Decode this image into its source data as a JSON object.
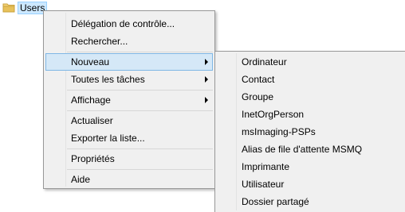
{
  "tree": {
    "node_label": "Users",
    "node_icon": "folder-icon"
  },
  "context_menu": {
    "items": [
      {
        "label": "Délégation de contrôle..."
      },
      {
        "label": "Rechercher..."
      },
      {
        "label": "Nouveau",
        "has_submenu": true,
        "active": true
      },
      {
        "label": "Toutes les tâches",
        "has_submenu": true
      },
      {
        "label": "Affichage",
        "has_submenu": true
      },
      {
        "label": "Actualiser"
      },
      {
        "label": "Exporter la liste..."
      },
      {
        "label": "Propriétés"
      },
      {
        "label": "Aide"
      }
    ]
  },
  "submenu_nouveau": {
    "items": [
      {
        "label": "Ordinateur"
      },
      {
        "label": "Contact"
      },
      {
        "label": "Groupe"
      },
      {
        "label": "InetOrgPerson"
      },
      {
        "label": "msImaging-PSPs"
      },
      {
        "label": "Alias de file d'attente MSMQ"
      },
      {
        "label": "Imprimante"
      },
      {
        "label": "Utilisateur"
      },
      {
        "label": "Dossier partagé"
      }
    ]
  },
  "colors": {
    "menu_background": "#f0f0f0",
    "menu_border": "#979797",
    "highlight_background": "#d5e8f7",
    "highlight_border": "#7fb7e5",
    "selected_node_background": "#cce8ff",
    "folder_yellow": "#e8c15a"
  }
}
